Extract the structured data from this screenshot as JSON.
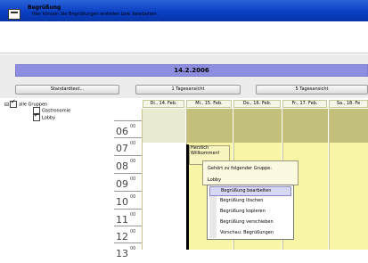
{
  "header": {
    "title": "Begrüßung",
    "subtitle": "Hier können Sie Begrüßungen erstellen bzw. bearbeiten."
  },
  "date_bar": "14.2.2006",
  "toolbar": {
    "standard_text": "Standardtext...",
    "day_view": "1 Tagesansicht",
    "five_day_view": "5 Tagesansicht"
  },
  "tree": {
    "root": "alle Gruppen",
    "root_checked": true,
    "children": [
      {
        "label": "Gastronomie",
        "checked": false
      },
      {
        "label": "Lobby",
        "checked": true
      }
    ]
  },
  "calendar": {
    "days": [
      "Di., 14. Feb.",
      "Mi., 15. Feb.",
      "Do., 16. Feb.",
      "Fr., 17. Feb.",
      "Sa., 18. Fe"
    ],
    "hours": [
      "06",
      "07",
      "08",
      "09",
      "10",
      "11",
      "12",
      "13"
    ],
    "minutes": "00",
    "event_text": "Herzlich Willkommen!"
  },
  "tooltip": {
    "line1": "Gehört zu folgender Gruppe:",
    "line2": "Lobby"
  },
  "context_menu": [
    {
      "label": "Begrüßung bearbeiten",
      "active": true
    },
    {
      "label": "Begrüßung löschen",
      "active": false
    },
    {
      "label": "Begrüßung kopieren",
      "active": false
    },
    {
      "label": "Begrüßung verschieben",
      "active": false
    },
    {
      "label": "Vorschau: Begrüßungen",
      "active": false
    }
  ],
  "colors": {
    "titlebar": "#0a3fc4",
    "date_bar": "#8e8ee0",
    "calendar_yellow": "#f8f5a6",
    "calendar_olive": "#c3c07b"
  }
}
